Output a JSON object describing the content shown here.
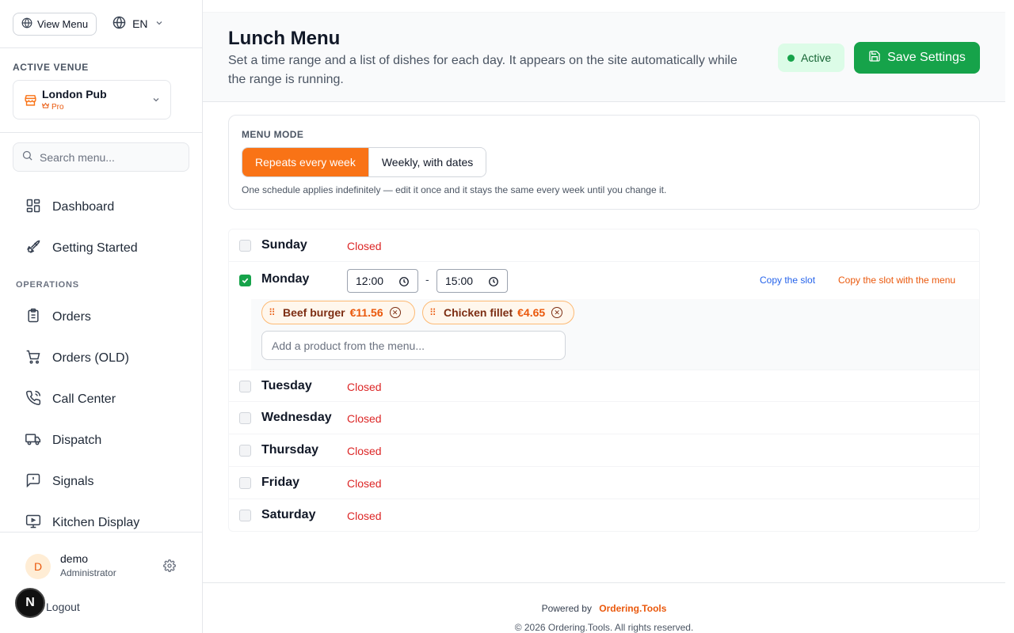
{
  "topbar": {
    "view_menu_label": "View Menu",
    "language": "EN"
  },
  "venue": {
    "section_label": "ACTIVE VENUE",
    "name": "London Pub",
    "plan": "Pro"
  },
  "search": {
    "placeholder": "Search menu..."
  },
  "nav": {
    "items": [
      {
        "label": "Dashboard",
        "icon": "dashboard-icon"
      },
      {
        "label": "Getting Started",
        "icon": "rocket-icon"
      }
    ],
    "operations_label": "OPERATIONS",
    "operations": [
      {
        "label": "Orders",
        "icon": "clipboard-icon"
      },
      {
        "label": "Orders (OLD)",
        "icon": "cart-icon"
      },
      {
        "label": "Call Center",
        "icon": "phone-icon"
      },
      {
        "label": "Dispatch",
        "icon": "truck-icon"
      },
      {
        "label": "Signals",
        "icon": "alert-message-icon"
      },
      {
        "label": "Kitchen Display",
        "icon": "monitor-icon"
      }
    ]
  },
  "user": {
    "initial": "D",
    "name": "demo",
    "role": "Administrator",
    "logout_label": "Logout"
  },
  "header": {
    "title": "Lunch Menu",
    "description": "Set a time range and a list of dishes for each day. It appears on the site automatically while the range is running.",
    "status": "Active",
    "save_label": "Save Settings"
  },
  "menu_mode": {
    "label": "MENU MODE",
    "options": [
      "Repeats every week",
      "Weekly, with dates"
    ],
    "selected": "Repeats every week",
    "help": "One schedule applies indefinitely — edit it once and it stays the same every week until you change it."
  },
  "days": {
    "closed_label": "Closed",
    "sunday": {
      "name": "Sunday",
      "enabled": false
    },
    "monday": {
      "name": "Monday",
      "enabled": true,
      "start": "12:00",
      "end": "15:00",
      "range_separator": "-",
      "copy_slot_label": "Copy the slot",
      "copy_menu_label": "Copy the slot with the menu",
      "dishes": [
        {
          "name": "Beef burger",
          "price": "€11.56"
        },
        {
          "name": "Chicken fillet",
          "price": "€4.65"
        }
      ],
      "add_placeholder": "Add a product from the menu..."
    },
    "tuesday": {
      "name": "Tuesday",
      "enabled": false
    },
    "wednesday": {
      "name": "Wednesday",
      "enabled": false
    },
    "thursday": {
      "name": "Thursday",
      "enabled": false
    },
    "friday": {
      "name": "Friday",
      "enabled": false
    },
    "saturday": {
      "name": "Saturday",
      "enabled": false
    }
  },
  "footer": {
    "powered_by": "Powered by",
    "brand": "Ordering.Tools",
    "copyright": "© 2026 Ordering.Tools. All rights reserved."
  },
  "colors": {
    "accent": "#f97316",
    "success": "#16a34a",
    "danger": "#dc2626",
    "link": "#2563eb"
  }
}
